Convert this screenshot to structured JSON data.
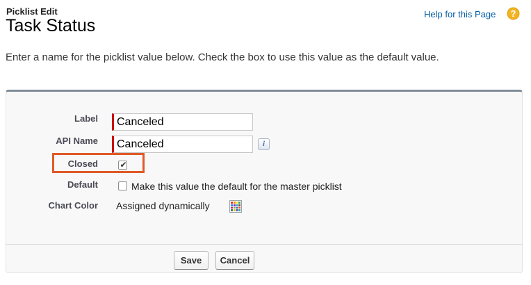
{
  "header": {
    "page_type": "Picklist Edit",
    "title": "Task Status",
    "help_link": "Help for this Page",
    "help_icon": "question-circle-icon"
  },
  "instructions": "Enter a name for the picklist value below. Check the box to use this value as the default value.",
  "form": {
    "label_field": {
      "label": "Label",
      "value": "Canceled",
      "required": true
    },
    "api_name_field": {
      "label": "API Name",
      "value": "Canceled",
      "required": true,
      "info_icon": "info-icon"
    },
    "closed_field": {
      "label": "Closed",
      "checked": true,
      "highlighted": true
    },
    "default_field": {
      "label": "Default",
      "checked": false,
      "text": "Make this value the default for the master picklist"
    },
    "chart_color_field": {
      "label": "Chart Color",
      "value": "Assigned dynamically",
      "icon": "color-palette-icon"
    }
  },
  "buttons": {
    "save": "Save",
    "cancel": "Cancel"
  },
  "colors": {
    "link": "#015ba7",
    "required_bar": "#cc0000",
    "highlight_border": "#e05a28",
    "help_icon": "#e8a317",
    "panel_bg": "#f8f8f8"
  }
}
